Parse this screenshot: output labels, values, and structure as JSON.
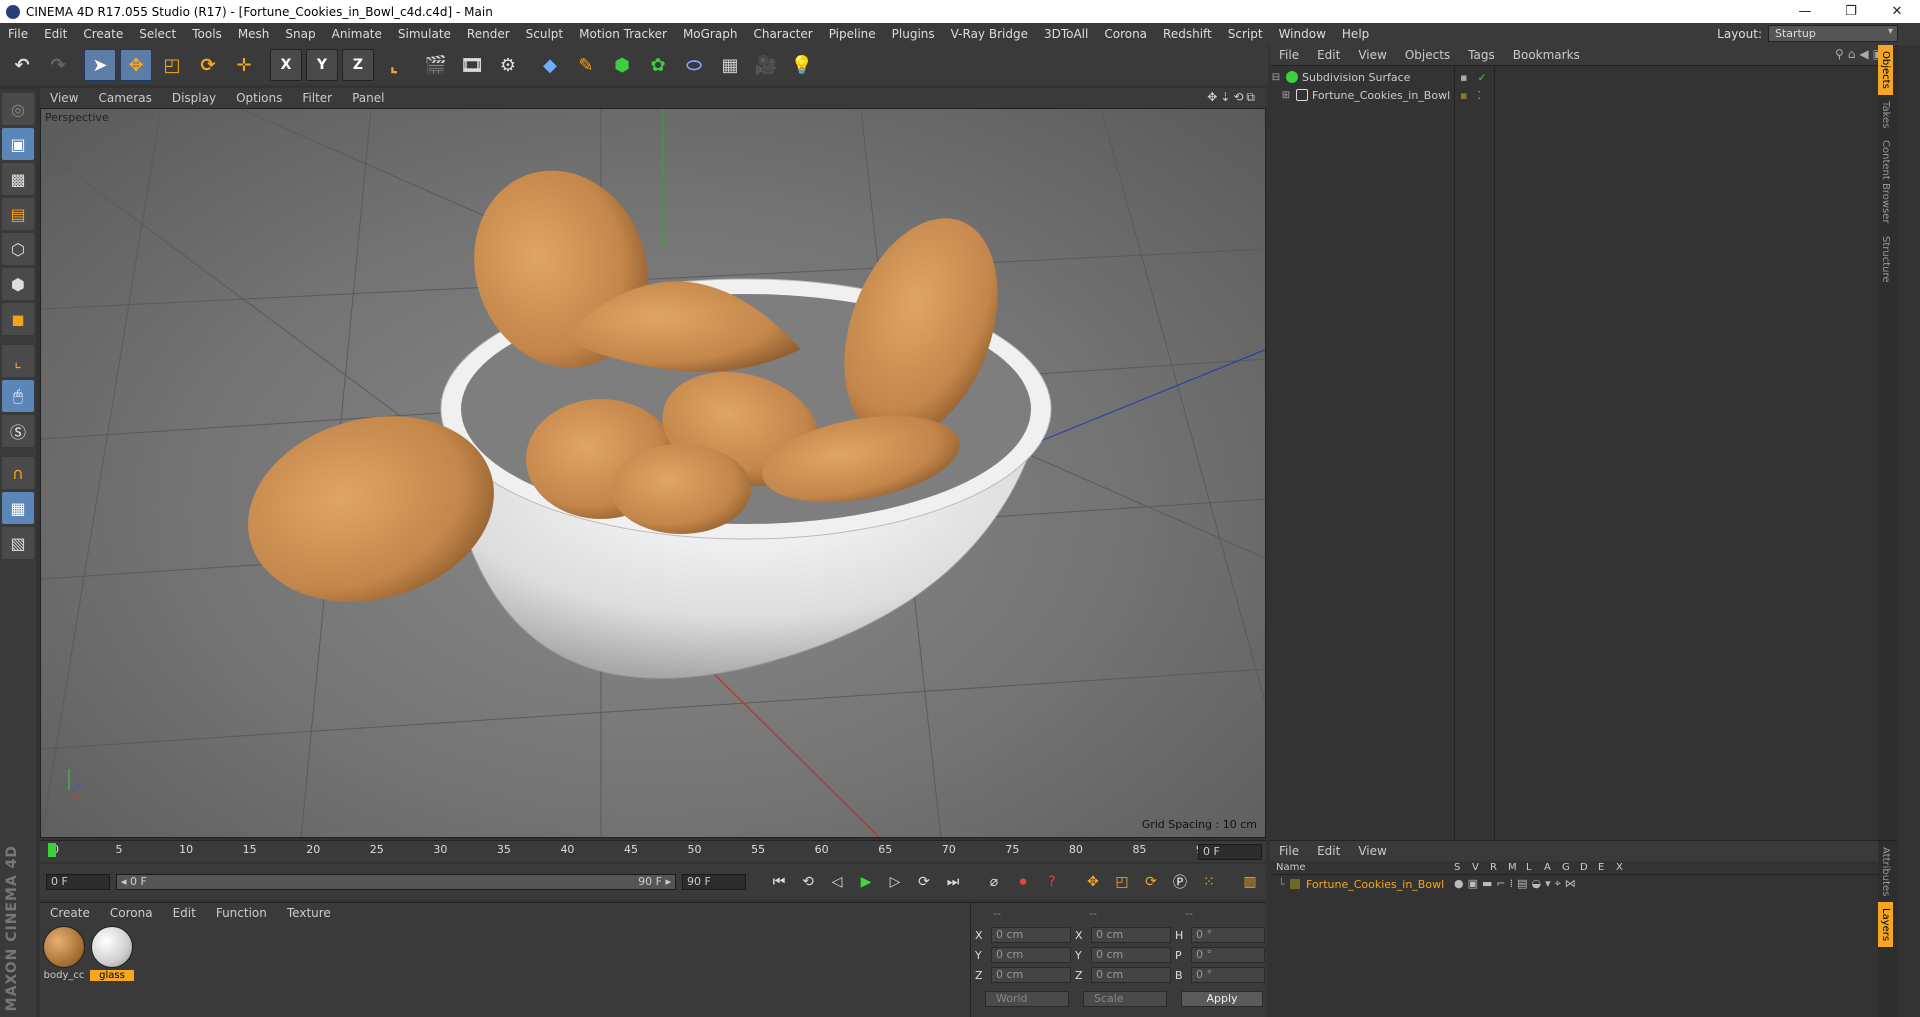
{
  "window": {
    "title": "CINEMA 4D R17.055 Studio (R17) - [Fortune_Cookies_in_Bowl_c4d.c4d] - Main",
    "minimize": "—",
    "maximize": "❐",
    "close": "✕"
  },
  "menubar": {
    "items": [
      "File",
      "Edit",
      "Create",
      "Select",
      "Tools",
      "Mesh",
      "Snap",
      "Animate",
      "Simulate",
      "Render",
      "Sculpt",
      "Motion Tracker",
      "MoGraph",
      "Character",
      "Pipeline",
      "Plugins",
      "V-Ray Bridge",
      "3DToAll",
      "Corona",
      "Redshift",
      "Script",
      "Window",
      "Help"
    ],
    "layout_label": "Layout:",
    "layout_value": "Startup"
  },
  "toolbar": {
    "axis_x": "X",
    "axis_y": "Y",
    "axis_z": "Z"
  },
  "viewport": {
    "menu": [
      "View",
      "Cameras",
      "Display",
      "Options",
      "Filter",
      "Panel"
    ],
    "label": "Perspective",
    "grid_spacing": "Grid Spacing : 10 cm"
  },
  "timeline": {
    "ticks": [
      "0",
      "5",
      "10",
      "15",
      "20",
      "25",
      "30",
      "35",
      "40",
      "45",
      "50",
      "55",
      "60",
      "65",
      "70",
      "75",
      "80",
      "85",
      "90"
    ],
    "current_frame": "0 F",
    "start_field": "0 F",
    "range_start": "◂ 0 F",
    "range_end": "90 F ▸",
    "end_field": "90 F"
  },
  "materials": {
    "menu": [
      "Create",
      "Corona",
      "Edit",
      "Function",
      "Texture"
    ],
    "items": [
      {
        "label": "body_cc",
        "color": "#b07a3a"
      },
      {
        "label": "glass",
        "color": "#e6e6e6"
      }
    ]
  },
  "coordinates": {
    "headers": [
      "--",
      "--",
      "--"
    ],
    "rows": [
      {
        "a1": "X",
        "v1": "0 cm",
        "a2": "X",
        "v2": "0 cm",
        "a3": "H",
        "v3": "0 °"
      },
      {
        "a1": "Y",
        "v1": "0 cm",
        "a2": "Y",
        "v2": "0 cm",
        "a3": "P",
        "v3": "0 °"
      },
      {
        "a1": "Z",
        "v1": "0 cm",
        "a2": "Z",
        "v2": "0 cm",
        "a3": "B",
        "v3": "0 °"
      }
    ],
    "world": "World",
    "scale": "Scale",
    "apply": "Apply"
  },
  "object_manager": {
    "menu": [
      "File",
      "Edit",
      "View",
      "Objects",
      "Tags",
      "Bookmarks"
    ],
    "objects": [
      {
        "name": "Subdivision Surface",
        "color": "#3ad13a"
      },
      {
        "name": "Fortune_Cookies_in_Bowl",
        "color": "#d8d8d8"
      }
    ],
    "side_tabs": [
      "Objects",
      "Takes",
      "Content Browser",
      "Structure"
    ]
  },
  "layers": {
    "menu": [
      "File",
      "Edit",
      "View"
    ],
    "columns": [
      "Name",
      "S",
      "V",
      "R",
      "M",
      "L",
      "A",
      "G",
      "D",
      "E",
      "X"
    ],
    "row_name": "Fortune_Cookies_in_Bowl",
    "side_tabs": [
      "Attributes",
      "Layers"
    ]
  },
  "colors": {
    "accent": "#f5a623",
    "tool_blue": "#5b86b8",
    "cookie": "#c8894a",
    "bowl": "#e8e8e8"
  }
}
